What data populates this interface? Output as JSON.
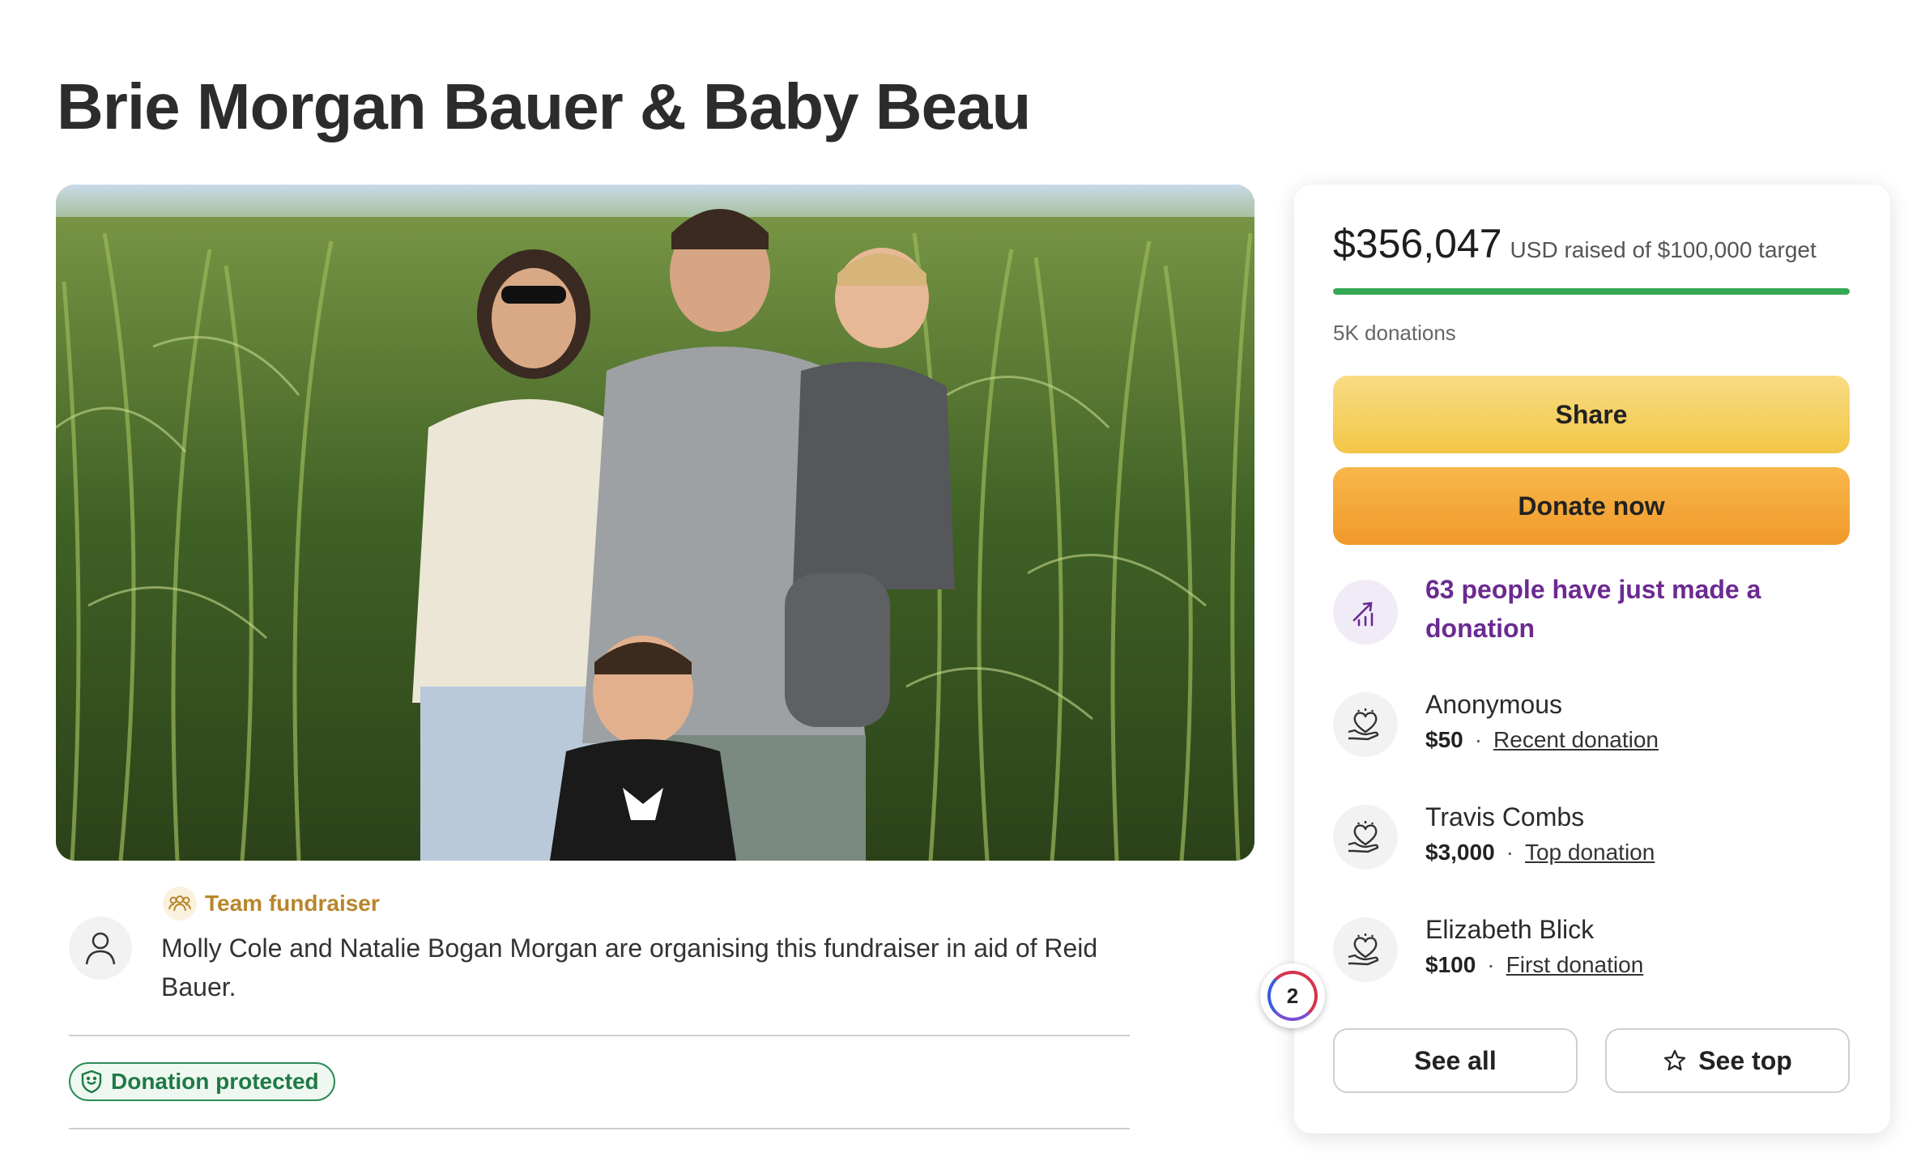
{
  "page": {
    "title": "Brie Morgan Bauer & Baby Beau"
  },
  "organiser": {
    "team_label": "Team fundraiser",
    "text": "Molly Cole and Natalie Bogan Morgan are organising this fundraiser in aid of Reid Bauer.",
    "protected_label": "Donation protected"
  },
  "card": {
    "raised_amount": "$356,047",
    "raised_rest": "USD raised of $100,000 target",
    "progress_fraction": 1.0,
    "donations_count": "5K donations",
    "share_label": "Share",
    "donate_label": "Donate now",
    "trend_text": "63 people have just made a donation",
    "donors": [
      {
        "name": "Anonymous",
        "amount": "$50",
        "tag": "Recent donation"
      },
      {
        "name": "Travis Combs",
        "amount": "$3,000",
        "tag": "Top donation"
      },
      {
        "name": "Elizabeth Blick",
        "amount": "$100",
        "tag": "First donation"
      }
    ],
    "see_all_label": "See all",
    "see_top_label": "See top"
  },
  "badge": {
    "count": "2"
  },
  "colors": {
    "progress": "#34a853",
    "share": "#f3c646",
    "donate": "#f09a2a",
    "trend_text": "#6b2a91",
    "team": "#b8862b",
    "protected": "#1f7a45"
  },
  "icons": {
    "organiser": "user-icon",
    "team": "team-icon",
    "protected": "shield-icon",
    "trend": "trending-up-icon",
    "donor": "donation-heart-icon",
    "see_top": "star-icon"
  }
}
